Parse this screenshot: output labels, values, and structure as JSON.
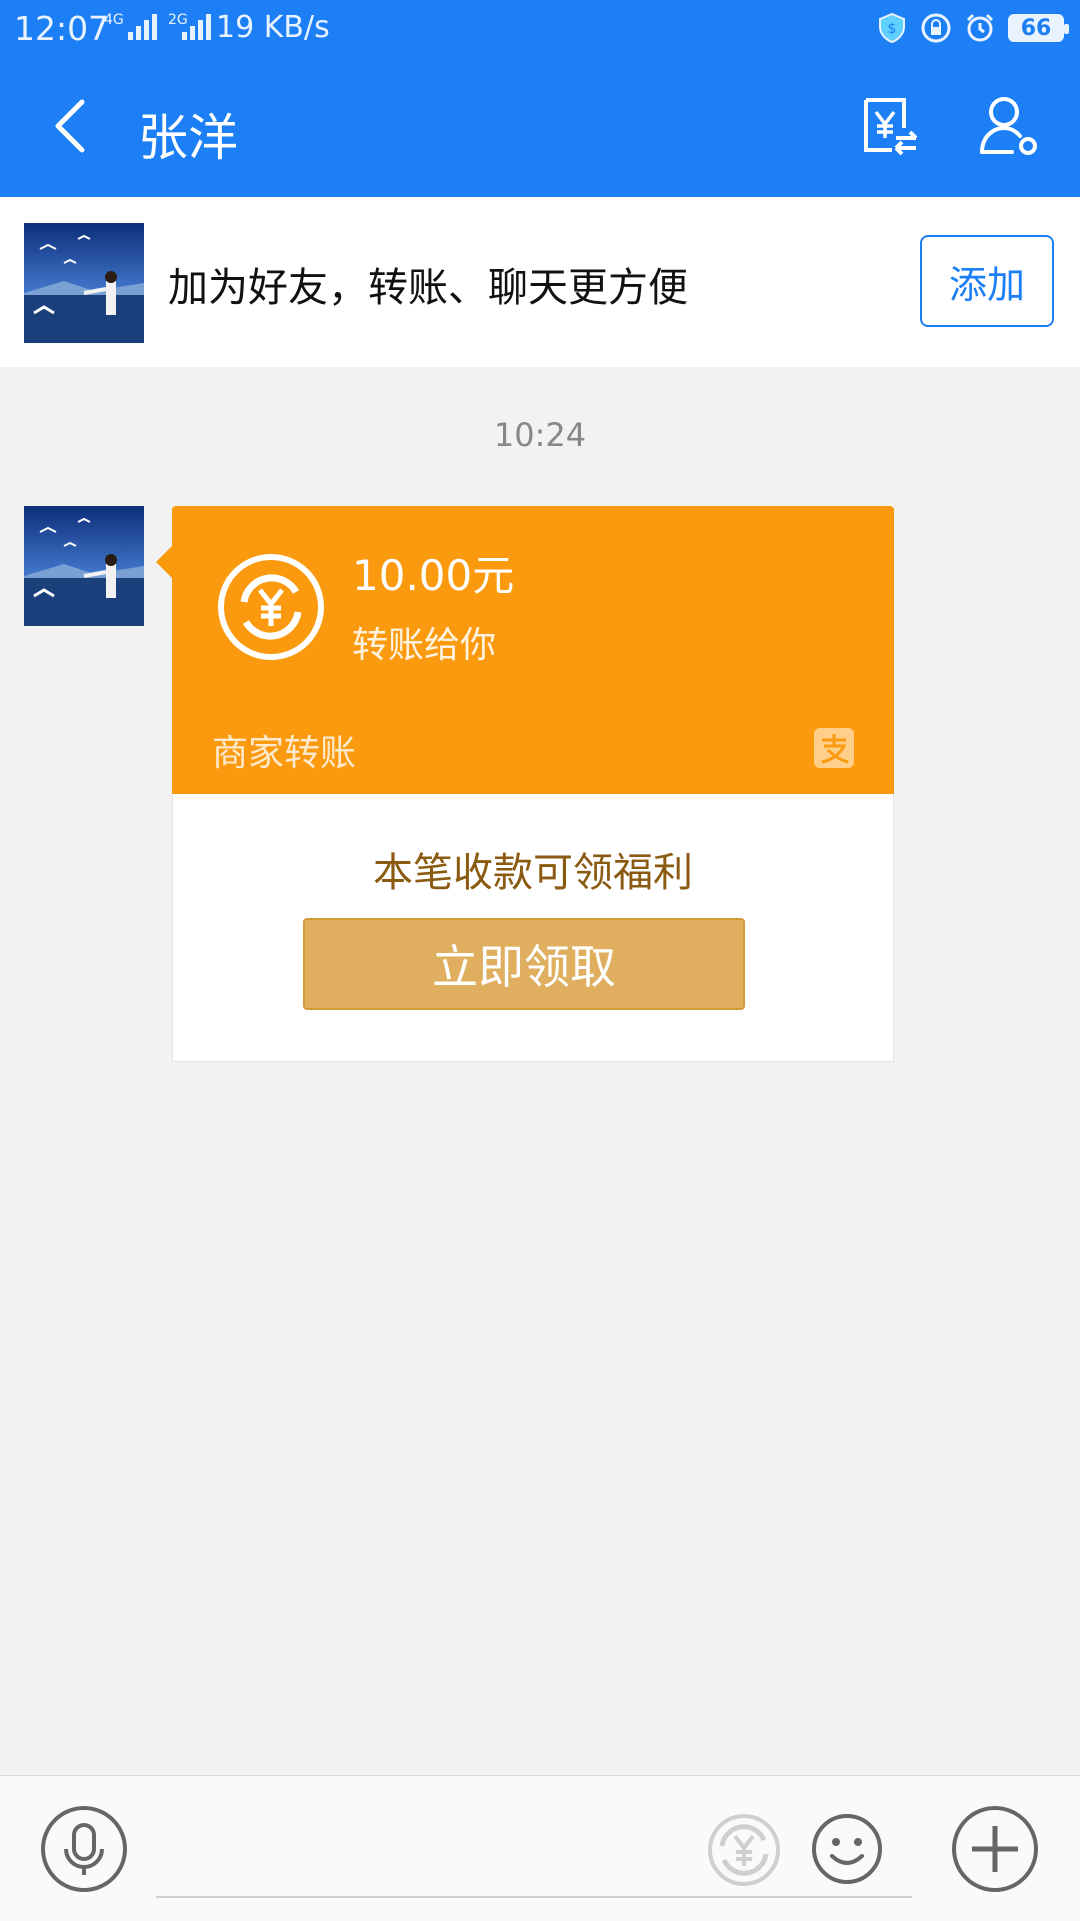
{
  "status_bar": {
    "time": "12:07",
    "network_primary": "4G",
    "network_secondary": "2G",
    "speed": "19 KB/s",
    "battery": "66"
  },
  "nav": {
    "title": "张洋"
  },
  "friend_banner": {
    "text": "加为好友，转账、聊天更方便",
    "add_label": "添加"
  },
  "chat": {
    "timestamp": "10:24",
    "transfer_card": {
      "amount": "10.00元",
      "subtitle": "转账给你",
      "merchant_label": "商家转账",
      "benefit_text": "本笔收款可领福利",
      "claim_label": "立即领取"
    }
  },
  "input": {
    "placeholder": ""
  },
  "colors": {
    "brand_blue": "#1c7ff5",
    "transfer_orange": "#fb9a0e",
    "claim_gold": "#dfaf5f"
  }
}
